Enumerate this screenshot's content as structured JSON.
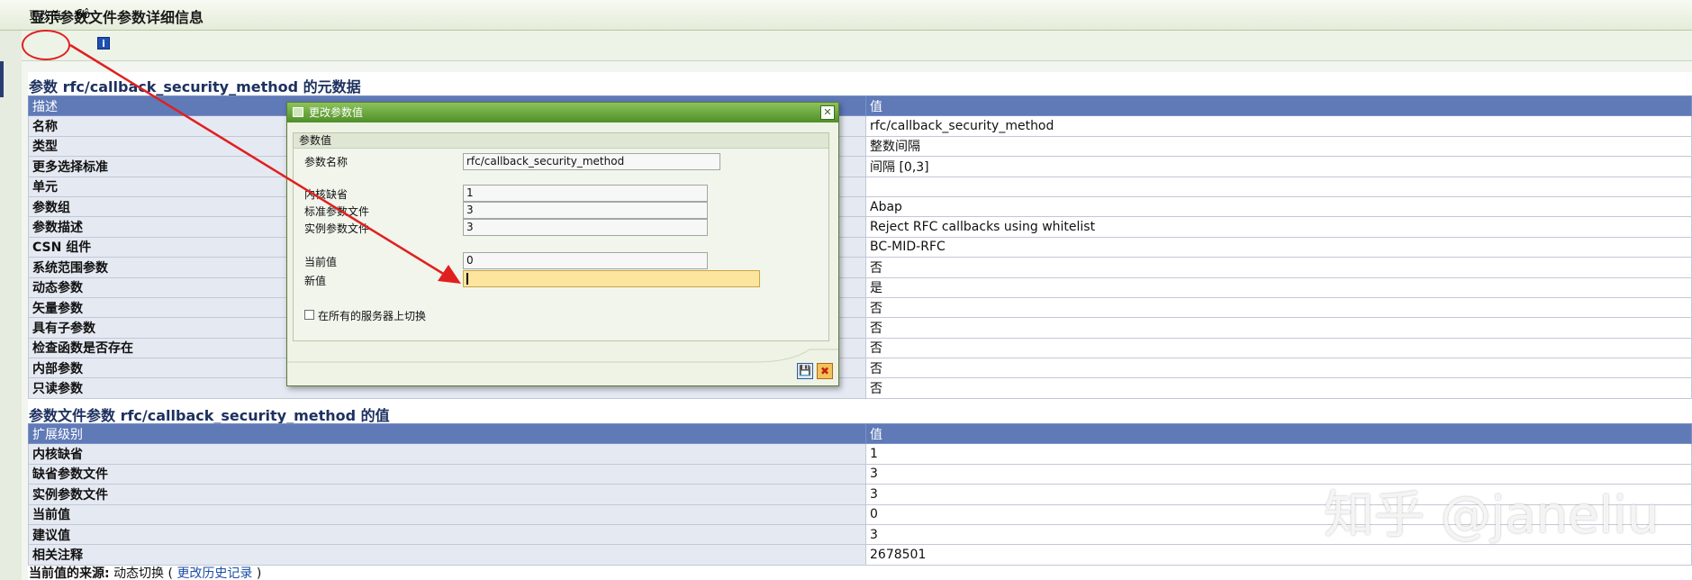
{
  "window": {
    "title": "显示参数文件参数详细信息"
  },
  "toolbar": {
    "change_value": "更改值",
    "display_icon_label": "6ô",
    "info_icon_label": "i"
  },
  "metadata": {
    "title": "参数 rfc/callback_security_method 的元数据",
    "header": {
      "col1": "描述",
      "col2": "值"
    },
    "rows": [
      {
        "label": "名称",
        "value": "rfc/callback_security_method"
      },
      {
        "label": "类型",
        "value": "整数间隔"
      },
      {
        "label": "更多选择标准",
        "value": "间隔 [0,3]"
      },
      {
        "label": "单元",
        "value": ""
      },
      {
        "label": "参数组",
        "value": "Abap"
      },
      {
        "label": "参数描述",
        "value": "Reject RFC callbacks using whitelist"
      },
      {
        "label": "CSN 组件",
        "value": "BC-MID-RFC"
      },
      {
        "label": "系统范围参数",
        "value": "否"
      },
      {
        "label": "动态参数",
        "value": "是"
      },
      {
        "label": "矢量参数",
        "value": "否"
      },
      {
        "label": "具有子参数",
        "value": "否"
      },
      {
        "label": "检查函数是否存在",
        "value": "否"
      },
      {
        "label": "内部参数",
        "value": "否"
      },
      {
        "label": "只读参数",
        "value": "否"
      }
    ]
  },
  "values": {
    "title": "参数文件参数 rfc/callback_security_method 的值",
    "header": {
      "col1": "扩展级别",
      "col2": "值"
    },
    "rows": [
      {
        "label": "内核缺省",
        "value": "1"
      },
      {
        "label": "缺省参数文件",
        "value": "3"
      },
      {
        "label": "实例参数文件",
        "value": "3"
      },
      {
        "label": "当前值",
        "value": "0"
      },
      {
        "label": "建议值",
        "value": "3"
      },
      {
        "label": "相关注释",
        "value": "2678501"
      }
    ]
  },
  "source": {
    "label": "当前值的来源:",
    "text": "动态切换 (",
    "link": "更改历史记录",
    "close": ")"
  },
  "dialog": {
    "title": "更改参数值",
    "group_title": "参数值",
    "param_name_label": "参数名称",
    "param_name_value": "rfc/callback_security_method",
    "kernel_default_label": "内核缺省",
    "kernel_default_value": "1",
    "default_profile_label": "标准参数文件",
    "default_profile_value": "3",
    "instance_profile_label": "实例参数文件",
    "instance_profile_value": "3",
    "current_label": "当前值",
    "current_value": "0",
    "new_label": "新值",
    "new_value": "",
    "all_servers_label": "在所有的服务器上切换",
    "save_icon": "💾",
    "cancel_icon": "✖"
  },
  "watermark": "知乎 @janeliu",
  "colors": {
    "header_blue": "#5f7ab7",
    "label_bg": "#e5e9f2",
    "dialog_green": "#4f8f28",
    "annotation_red": "#e02020"
  }
}
